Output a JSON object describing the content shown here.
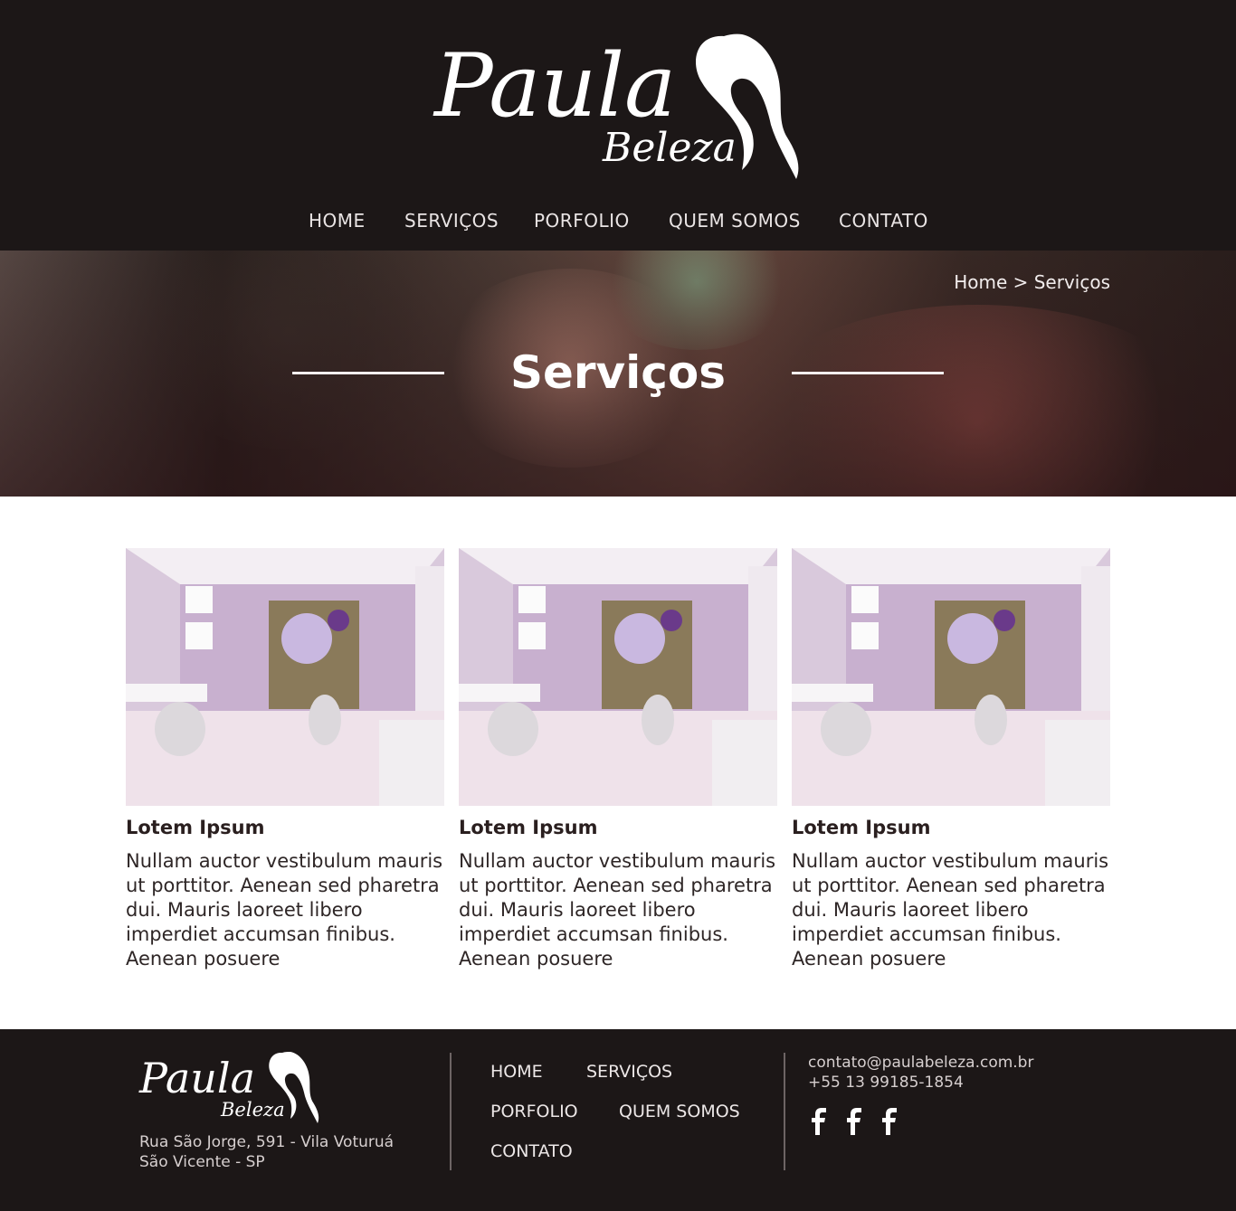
{
  "brand": {
    "name": "Paula",
    "sub": "Beleza"
  },
  "nav": [
    "HOME",
    "SERVIÇOS",
    "PORFOLIO",
    "QUEM SOMOS",
    "CONTATO"
  ],
  "breadcrumb": "Home > Serviços",
  "hero_title": "Serviços",
  "cards": [
    {
      "title": "Lotem Ipsum",
      "text": "Nullam auctor vestibulum mauris ut porttitor. Aenean sed pharetra dui. Mauris laoreet libero imperdiet accumsan finibus. Aenean posuere"
    },
    {
      "title": "Lotem Ipsum",
      "text": "Nullam auctor vestibulum mauris ut porttitor. Aenean sed pharetra dui. Mauris laoreet libero imperdiet accumsan finibus. Aenean posuere"
    },
    {
      "title": "Lotem Ipsum",
      "text": "Nullam auctor vestibulum mauris ut porttitor. Aenean sed pharetra dui. Mauris laoreet libero imperdiet accumsan finibus. Aenean posuere"
    }
  ],
  "footer": {
    "address_line1": "Rua São Jorge, 591 -  Vila Voturuá",
    "address_line2": "São Vicente - SP",
    "nav": [
      "HOME",
      "SERVIÇOS",
      "PORFOLIO",
      "QUEM SOMOS",
      "CONTATO"
    ],
    "email": "contato@paulabeleza.com.br",
    "phone": "+55 13 99185-1854",
    "social_icons": [
      "facebook-icon",
      "facebook-icon",
      "facebook-icon"
    ]
  },
  "colors": {
    "dark": "#1c1717",
    "text": "#2e2626",
    "light": "#ffffff"
  }
}
